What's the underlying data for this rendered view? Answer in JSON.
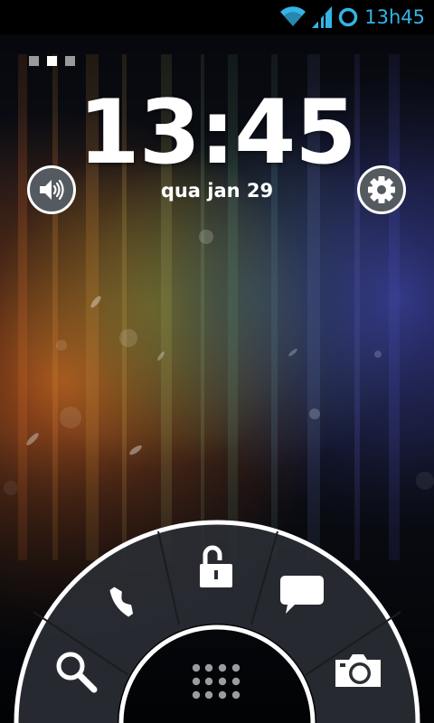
{
  "status_bar": {
    "time": "13h45",
    "icons": [
      "wifi-icon",
      "signal-icon",
      "sync-ring-icon"
    ],
    "accent": "#33b5e5"
  },
  "lockscreen": {
    "pager": {
      "count": 3,
      "active": 1
    },
    "clock": "13:45",
    "date": "qua jan 29",
    "left_button": "sound-icon",
    "right_button": "settings-icon"
  },
  "ring_targets": [
    "search-icon",
    "phone-icon",
    "unlock-icon",
    "message-icon",
    "camera-icon",
    "apps-grid-icon"
  ]
}
